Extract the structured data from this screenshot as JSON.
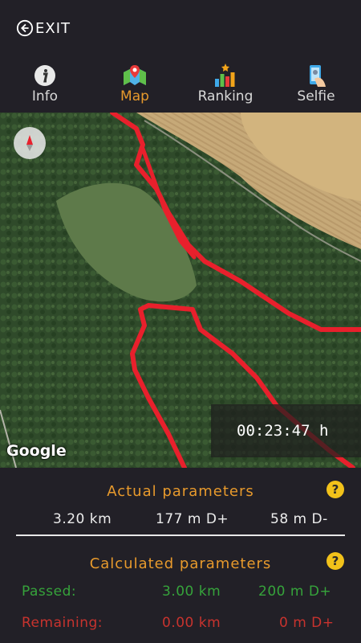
{
  "header": {
    "exit_label": "EXIT"
  },
  "tabs": [
    {
      "label": "Info",
      "icon": "info-icon",
      "active": false
    },
    {
      "label": "Map",
      "icon": "map-icon",
      "active": true
    },
    {
      "label": "Ranking",
      "icon": "ranking-icon",
      "active": false
    },
    {
      "label": "Selfie",
      "icon": "selfie-icon",
      "active": false
    }
  ],
  "map": {
    "watermark": "Google",
    "timer": "00:23:47 h",
    "track_color": "#e8202c"
  },
  "actual": {
    "title": "Actual parameters",
    "distance": "3.20 km",
    "ascent": "177 m D+",
    "descent": "58 m D-"
  },
  "calculated": {
    "title": "Calculated parameters",
    "passed_label": "Passed:",
    "passed_distance": "3.00 km",
    "passed_ascent": "200 m D+",
    "remaining_label": "Remaining:",
    "remaining_distance": "0.00 km",
    "remaining_ascent": "0 m D+"
  },
  "colors": {
    "accent": "#e89a2c",
    "passed": "#36a33b",
    "remaining": "#c8332e",
    "help": "#f2c21a"
  }
}
